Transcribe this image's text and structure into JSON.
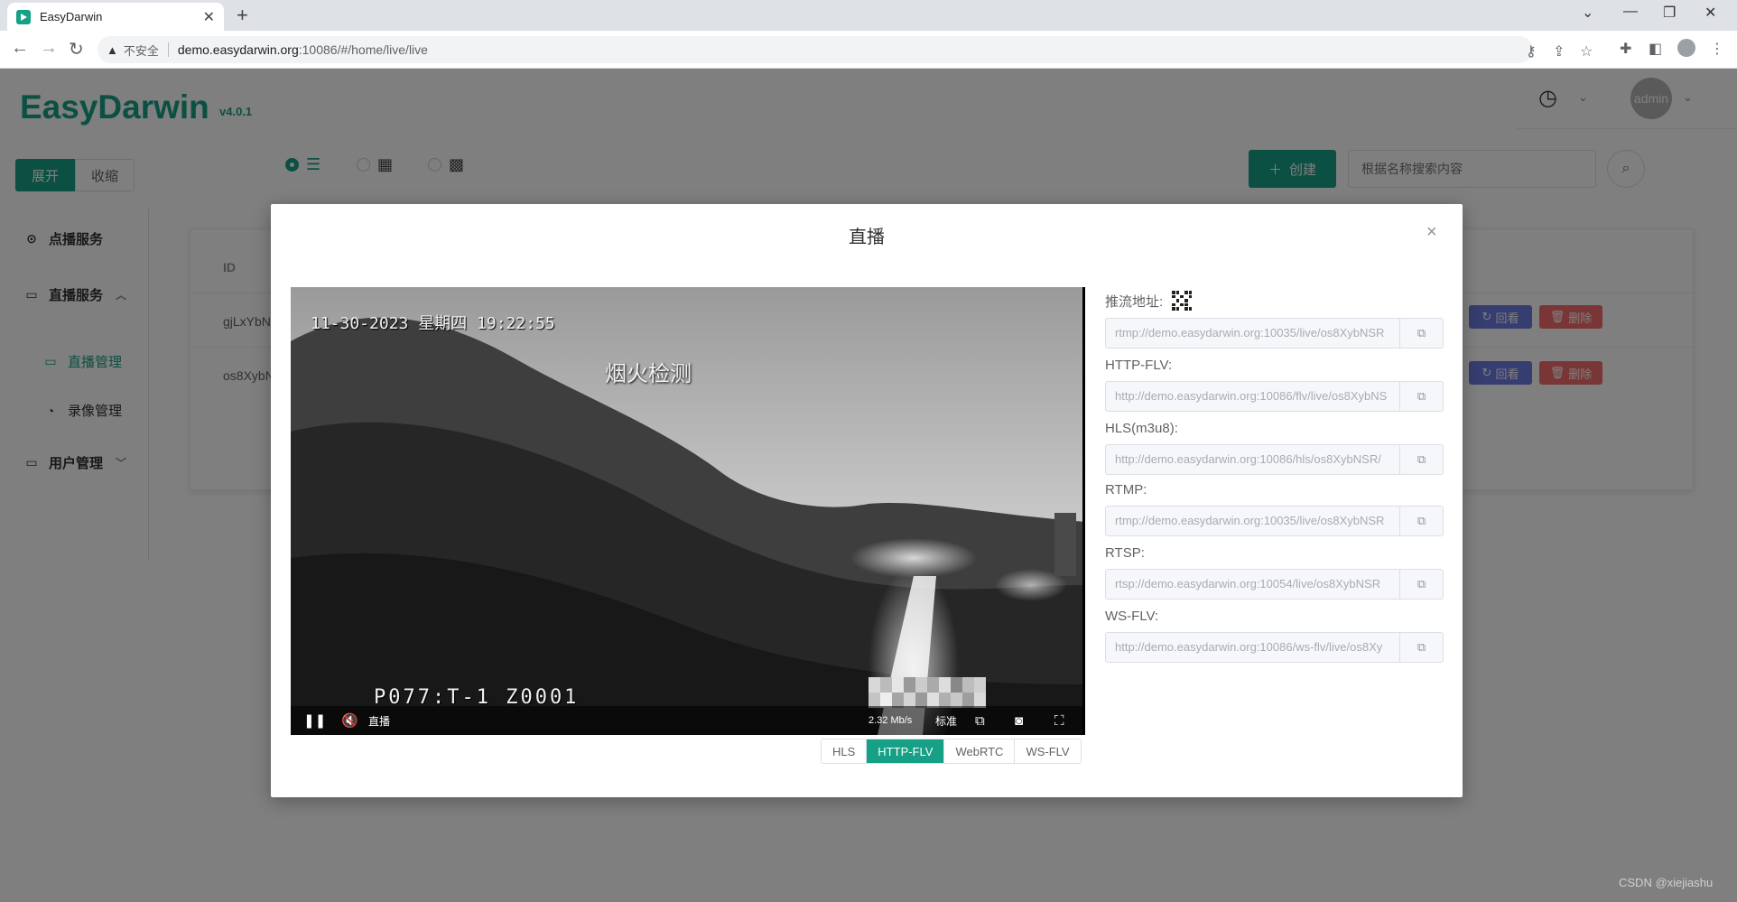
{
  "browser": {
    "tab_title": "EasyDarwin",
    "tab_close": "✕",
    "new_tab": "+",
    "security_label": "不安全",
    "url_host": "demo.easydarwin.org",
    "url_path": ":10086/#/home/live/live"
  },
  "app": {
    "logo": "EasyDarwin",
    "version": "v4.0.1",
    "expand_label": "展开",
    "collapse_label": "收缩",
    "avatar_text": "admin",
    "create_label": "创建",
    "search_placeholder": "根据名称搜索内容",
    "menu": {
      "vod": "点播服务",
      "live": "直播服务",
      "live_manage": "直播管理",
      "record_manage": "录像管理",
      "user_manage": "用户管理"
    },
    "table": {
      "col_id": "ID",
      "rows": [
        {
          "id": "gjLxYbN",
          "replay": "回看",
          "delete": "删除"
        },
        {
          "id": "os8XybN",
          "replay": "回看",
          "delete": "删除"
        }
      ]
    }
  },
  "dialog": {
    "title": "直播",
    "close": "×",
    "video": {
      "osd_time": "11-30-2023 星期四 19:22:55",
      "osd_label": "烟火检测",
      "osd_code": "P077:T-1   Z0001",
      "live_label": "直播",
      "bitrate": "2.32 Mb/s",
      "quality": "标准"
    },
    "protocol_tabs": [
      "HLS",
      "HTTP-FLV",
      "WebRTC",
      "WS-FLV"
    ],
    "active_protocol": "HTTP-FLV",
    "urls": [
      {
        "label": "推流地址:",
        "value": "rtmp://demo.easydarwin.org:10035/live/os8XybNSR"
      },
      {
        "label": "HTTP-FLV:",
        "value": "http://demo.easydarwin.org:10086/flv/live/os8XybNS"
      },
      {
        "label": "HLS(m3u8):",
        "value": "http://demo.easydarwin.org:10086/hls/os8XybNSR/"
      },
      {
        "label": "RTMP:",
        "value": "rtmp://demo.easydarwin.org:10035/live/os8XybNSR"
      },
      {
        "label": "RTSP:",
        "value": "rtsp://demo.easydarwin.org:10054/live/os8XybNSR"
      },
      {
        "label": "WS-FLV:",
        "value": "http://demo.easydarwin.org:10086/ws-flv/live/os8Xy"
      }
    ]
  },
  "watermark": "CSDN @xiejiashu",
  "colors": {
    "brand": "#16a085",
    "danger": "#f56c6c",
    "replay": "#6c7ae0"
  }
}
